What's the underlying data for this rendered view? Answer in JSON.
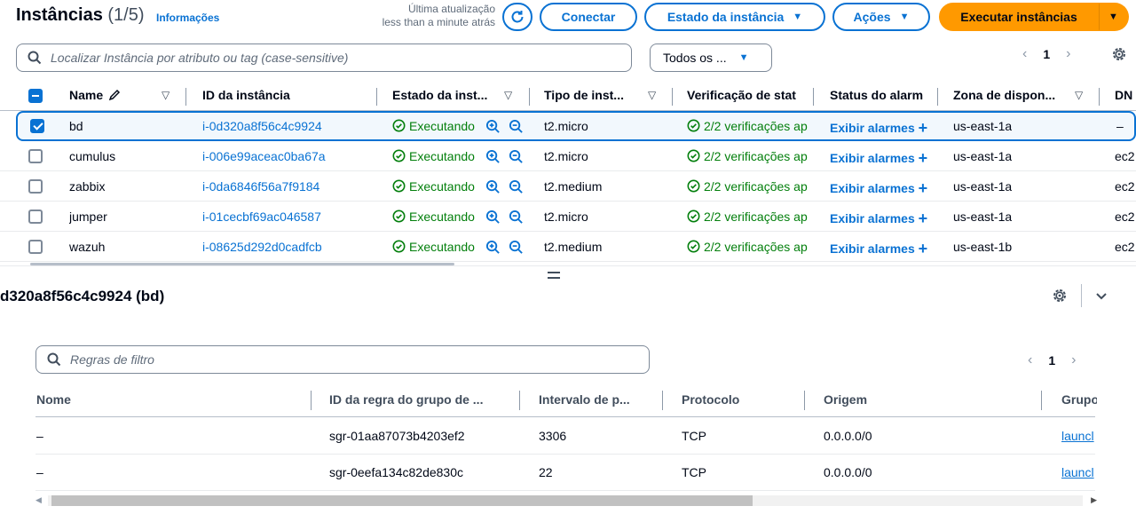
{
  "header": {
    "title": "Instâncias",
    "count": "(1/5)",
    "info_link": "Informações",
    "last_update_label": "Última atualização",
    "last_update_value": "less than a minute atrás",
    "connect_label": "Conectar",
    "state_label": "Estado da instância",
    "actions_label": "Ações",
    "launch_label": "Executar instâncias"
  },
  "search": {
    "placeholder": "Localizar Instância por atributo ou tag (case-sensitive)",
    "filter_select": "Todos os ...",
    "page": "1"
  },
  "instances_table": {
    "columns": [
      "Name",
      "ID da instância",
      "Estado da inst...",
      "Tipo de inst...",
      "Verificação de stat",
      "Status do alarm",
      "Zona de dispon...",
      "DN"
    ],
    "rows": [
      {
        "name": "bd",
        "id": "i-0d320a8f56c4c9924",
        "state": "Executando",
        "type": "t2.micro",
        "check": "2/2 verificações ap",
        "alarm": "Exibir alarmes",
        "zone": "us-east-1a",
        "dns": "–",
        "selected": true
      },
      {
        "name": "cumulus",
        "id": "i-006e99aceac0ba67a",
        "state": "Executando",
        "type": "t2.micro",
        "check": "2/2 verificações ap",
        "alarm": "Exibir alarmes",
        "zone": "us-east-1a",
        "dns": "ec2",
        "selected": false
      },
      {
        "name": "zabbix",
        "id": "i-0da6846f56a7f9184",
        "state": "Executando",
        "type": "t2.medium",
        "check": "2/2 verificações ap",
        "alarm": "Exibir alarmes",
        "zone": "us-east-1a",
        "dns": "ec2",
        "selected": false
      },
      {
        "name": "jumper",
        "id": "i-01cecbf69ac046587",
        "state": "Executando",
        "type": "t2.micro",
        "check": "2/2 verificações ap",
        "alarm": "Exibir alarmes",
        "zone": "us-east-1a",
        "dns": "ec2",
        "selected": false
      },
      {
        "name": "wazuh",
        "id": "i-08625d292d0cadfcb",
        "state": "Executando",
        "type": "t2.medium",
        "check": "2/2 verificações ap",
        "alarm": "Exibir alarmes",
        "zone": "us-east-1b",
        "dns": "ec2",
        "selected": false
      }
    ]
  },
  "detail": {
    "title": "d320a8f56c4c9924 (bd)",
    "search_placeholder": "Regras de filtro",
    "page": "1",
    "columns": [
      "Nome",
      "ID da regra do grupo de ...",
      "Intervalo de p...",
      "Protocolo",
      "Origem",
      "Grupo"
    ],
    "rows": [
      {
        "name": "–",
        "rule_id": "sgr-01aa87073b4203ef2",
        "port": "3306",
        "protocol": "TCP",
        "source": "0.0.0.0/0",
        "group": "launcl"
      },
      {
        "name": "–",
        "rule_id": "sgr-0eefa134c82de830c",
        "port": "22",
        "protocol": "TCP",
        "source": "0.0.0.0/0",
        "group": "launcl"
      }
    ]
  },
  "colors": {
    "accent": "#0972d3",
    "primary_button": "#ff9900",
    "success": "#037f0c"
  }
}
